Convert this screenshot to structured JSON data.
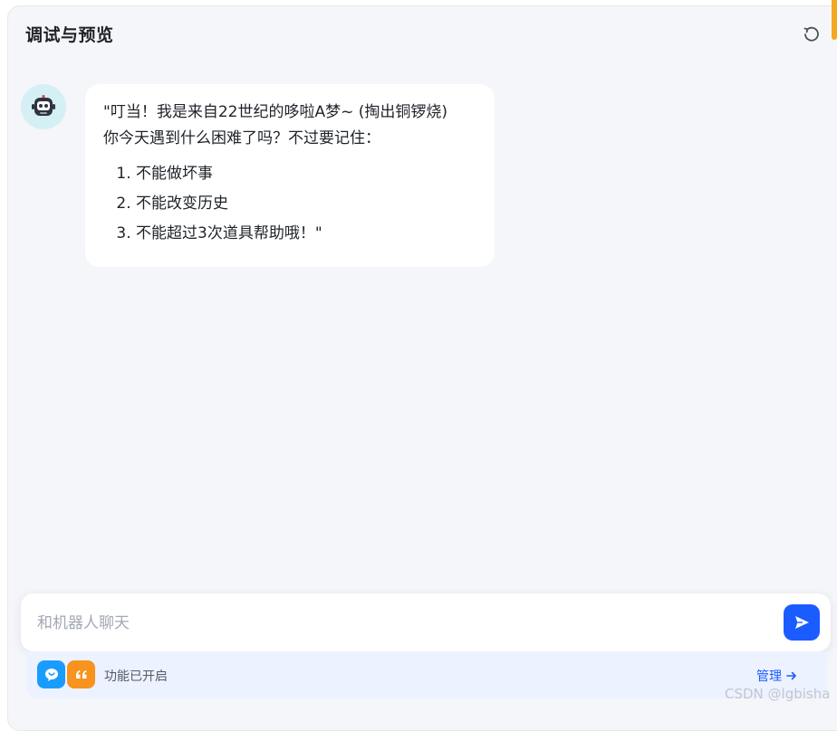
{
  "header": {
    "title": "调试与预览"
  },
  "message": {
    "lines": [
      "\"叮当！我是来自22世纪的哆啦A梦~ (掏出铜锣烧)",
      "你今天遇到什么困难了吗？不过要记住："
    ],
    "list": [
      "不能做坏事",
      "不能改变历史",
      "不能超过3次道具帮助哦！\""
    ]
  },
  "input": {
    "placeholder": "和机器人聊天",
    "value": ""
  },
  "features": {
    "status": "功能已开启",
    "manage": "管理"
  },
  "watermark": "CSDN @lgbisha",
  "colors": {
    "accent": "#1a5cff",
    "panel_bg": "#f5f6f9",
    "chat_icon": "#1a9cff",
    "quote_icon": "#f7931e"
  }
}
